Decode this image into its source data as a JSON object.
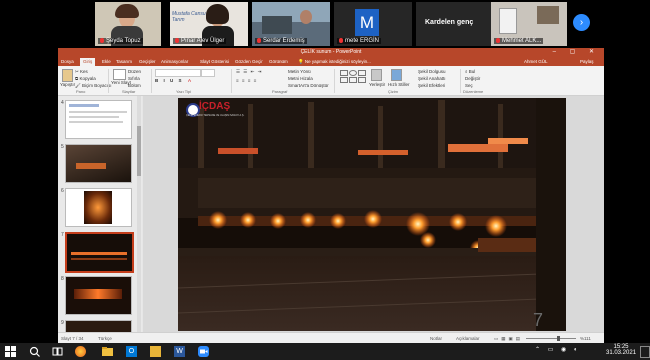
{
  "participants": [
    {
      "name": "Şeyda Topuz"
    },
    {
      "name": "Pınar Alev Ülger",
      "overlay_text": "Mustafa Cansu Tarım"
    },
    {
      "name": "Serdar Erdemiş"
    },
    {
      "name": "mete ERGİN",
      "avatar_letter": "M"
    },
    {
      "name": "Kardelen genç"
    },
    {
      "name": "Mehmet ALK..."
    }
  ],
  "powerpoint": {
    "title": "ÇELİK sunum - PowerPoint",
    "user": "Ahmet GÜL",
    "share": "Paylaş",
    "window_controls": "– ▢ ✕",
    "tabs": [
      "Dosya",
      "Giriş",
      "Ekle",
      "Tasarım",
      "Geçişler",
      "Animasyonlar",
      "Slayt Gösterisi",
      "Gözden Geçir",
      "Görünüm"
    ],
    "tell_me": "Ne yapmak istediğinizi söyleyin...",
    "ribbon": {
      "cut": "Kes",
      "copy": "Kopyala",
      "format_painter": "Biçim Boyacısı",
      "paste": "Yapıştır",
      "new_slide": "Yeni Slayt",
      "layout": "Düzen",
      "reset": "Sıfırla",
      "section": "Bölüm",
      "text_direction": "Metin Yönü",
      "align_text": "Metni Hizala",
      "smartart": "SmartArt'a Dönüştür",
      "arrange": "Yerleştir",
      "quick_styles": "Hızlı Stiller",
      "shape_fill": "Şekil Dolgusu",
      "shape_outline": "Şekil Anahattı",
      "shape_effects": "Şekil Efektleri",
      "find": "Bul",
      "replace": "Değiştir",
      "select": "Seç",
      "groups": {
        "clipboard": "Pano",
        "slides": "Slaytlar",
        "font": "Yazı Tipi",
        "paragraph": "Paragraf",
        "drawing": "Çizim",
        "editing": "Düzenleme"
      }
    },
    "slide_numbers": [
      "4",
      "5",
      "6",
      "7",
      "8",
      "9"
    ],
    "selected_slide": "7",
    "status": {
      "slide_info": "Slayt 7 / 34",
      "language": "Türkçe",
      "notes": "Notlar",
      "comments": "Açıklamalar",
      "zoom": "%111"
    },
    "slide_logo_text": "İÇDAŞ",
    "slide_logo_subtext": "ÇELİK ENERJİ TERSANE VE ULAŞIM SANAYİ A.Ş."
  },
  "taskbar": {
    "time": "15:25",
    "date": "31.03.2021"
  },
  "colors": {
    "ppt_accent": "#b7472a",
    "zoom_blue": "#2d8cff",
    "avatar_blue": "#1d62c4"
  }
}
